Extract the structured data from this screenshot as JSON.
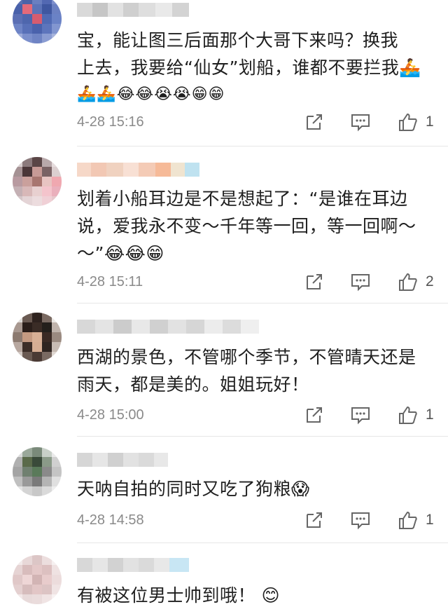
{
  "comments": [
    {
      "text_lines": [
        "宝，能让图三后面那个大哥下来吗？换我",
        "上去，我要给“仙女”划船，谁都不要拦我🚣"
      ],
      "emoji_line": "🚣🚣😂😂😭😭😁😁",
      "time": "4-28 15:16",
      "likes": "1"
    },
    {
      "text_lines": [
        "划着小船耳边是不是想起了：“是谁在耳边",
        "说，爱我永不变～千年等一回，等一回啊～",
        "～”😂😂😁"
      ],
      "emoji_line": "",
      "time": "4-28 15:11",
      "likes": "2"
    },
    {
      "text_lines": [
        "西湖的景色，不管哪个季节，不管晴天还是",
        "雨天，都是美的。姐姐玩好！"
      ],
      "emoji_line": "",
      "time": "4-28 15:00",
      "likes": "1"
    },
    {
      "text_lines": [
        "天呐自拍的同时又吃了狗粮😱"
      ],
      "emoji_line": "",
      "time": "4-28 14:58",
      "likes": "1"
    },
    {
      "text_lines": [
        "有被这位男士帅到哦！ 😊"
      ],
      "emoji_line": "",
      "time": "",
      "likes": ""
    }
  ],
  "icons": {
    "share": "share-icon",
    "reply": "reply-icon",
    "like": "thumbs-up-icon"
  }
}
